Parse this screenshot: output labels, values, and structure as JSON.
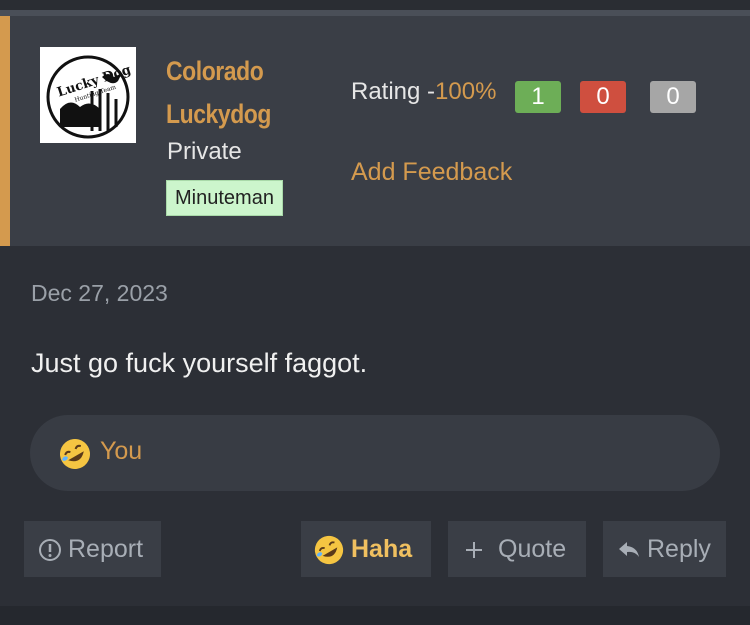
{
  "post": {
    "author": {
      "name_line1": "Colorado",
      "name_line2": "Luckydog",
      "rank": "Private",
      "badge": "Minuteman",
      "avatar_text": "Lucky Dog",
      "avatar_subtext": "Hunting Team"
    },
    "rating": {
      "label": "Rating -",
      "percent": "100%",
      "positive": "1",
      "negative": "0",
      "neutral": "0",
      "colors": {
        "positive": "#6dae57",
        "negative": "#cf4f3f",
        "neutral": "#a6a6a6"
      }
    },
    "feedback_link": "Add Feedback",
    "date": "Dec 27, 2023",
    "message": "Just go fuck yourself faggot.",
    "reactions": {
      "emoji": "rolling-on-floor-laughing-icon",
      "who": "You"
    }
  },
  "actions": {
    "report": "Report",
    "haha": "Haha",
    "quote": "Quote",
    "reply": "Reply"
  },
  "colors": {
    "accent": "#d49a4e",
    "background": "#2c2f36",
    "panel": "#3a3e46"
  }
}
